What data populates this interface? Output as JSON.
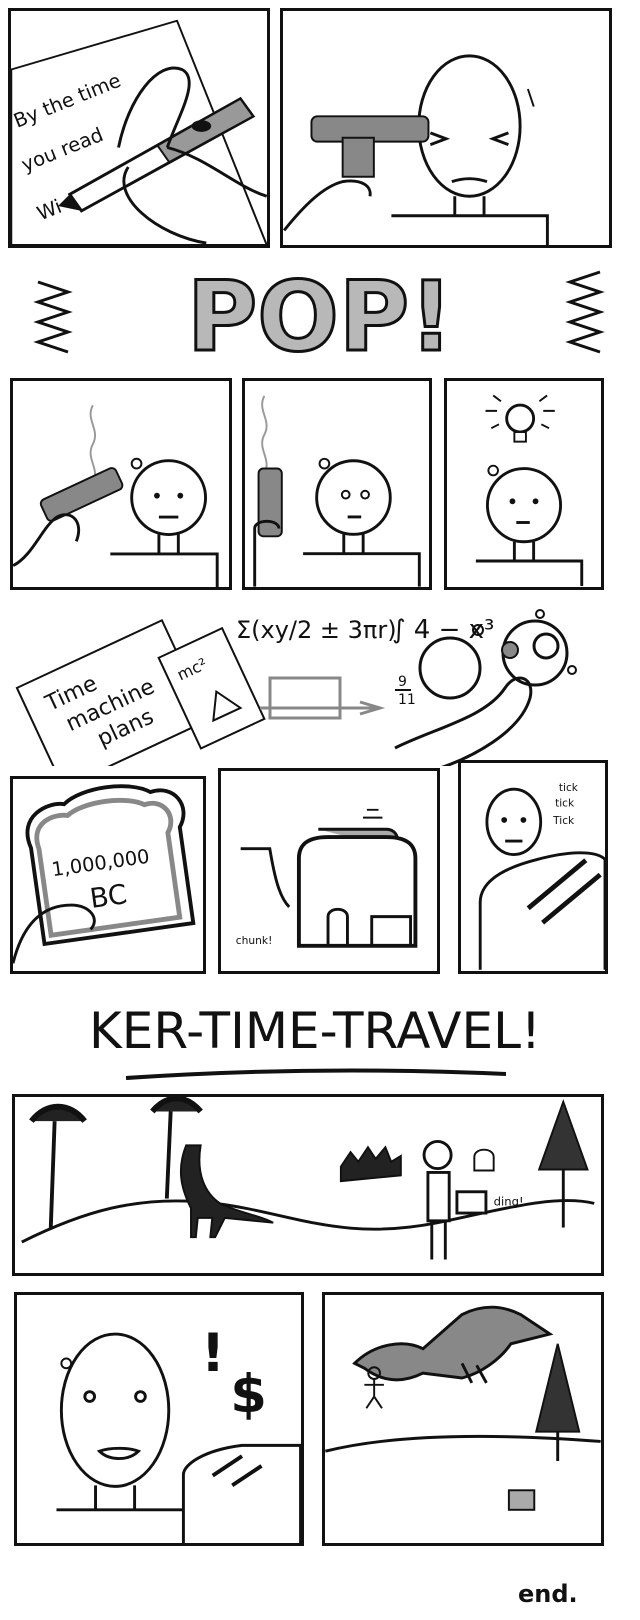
{
  "comic": {
    "panel1": {
      "note_text": [
        "By the time",
        "you read",
        "Wi"
      ]
    },
    "pop": {
      "text": "POP!"
    },
    "plans": {
      "paper1": [
        "Time",
        "machine",
        "plans"
      ],
      "paper2": "mc²",
      "equation": "Σ(xy/2 ± 3πr)",
      "integral": "∫ 4 − x³",
      "fraction_top": "9",
      "fraction_bottom": "11"
    },
    "toast": {
      "line1": "1,000,000",
      "line2": "BC"
    },
    "toaster": {
      "sfx": "chunk!"
    },
    "ticking": {
      "t1": "tick",
      "t2": "tick",
      "t3": "Tick"
    },
    "title": {
      "text": "KER-TIME-TRAVEL!"
    },
    "prehistoric": {
      "sfx": "ding!"
    },
    "realize": {
      "exclaim": "!",
      "dollar": "$"
    },
    "ending": {
      "text": "end."
    }
  }
}
